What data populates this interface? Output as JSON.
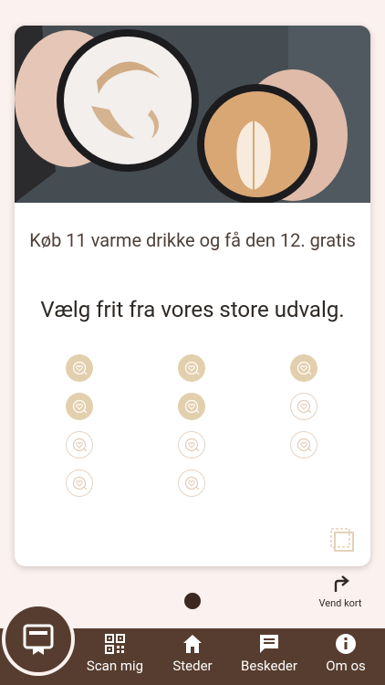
{
  "card": {
    "title": "Køb 11 varme drikke og få den 12. gratis",
    "subtitle": "Vælg frit fra vores store udvalg.",
    "stamps": {
      "total": 11,
      "collected": 5
    }
  },
  "pager": {
    "pages": 1,
    "current": 1
  },
  "flip": {
    "label": "Vend kort",
    "icon": "flip-arrow-icon"
  },
  "nav": {
    "fab_icon": "loyalty-card-icon",
    "items": [
      {
        "label": "Scan mig",
        "icon": "qr-code-icon"
      },
      {
        "label": "Steder",
        "icon": "home-icon"
      },
      {
        "label": "Beskeder",
        "icon": "message-icon"
      },
      {
        "label": "Om os",
        "icon": "info-icon"
      }
    ]
  },
  "colors": {
    "background": "#fbf1ee",
    "navbar": "#573d2f",
    "stamp_filled": "#e2cfae",
    "stamp_outline": "#e3d4c2"
  }
}
